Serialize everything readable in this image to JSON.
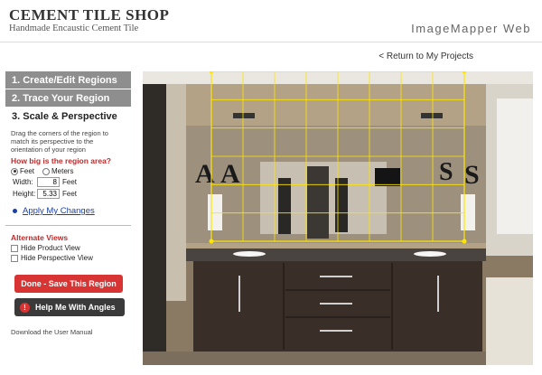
{
  "brand": {
    "title": "CEMENT TILE SHOP",
    "subtitle": "Handmade Encaustic Cement Tile"
  },
  "app": {
    "title": "ImageMapper Web"
  },
  "nav": {
    "return_link": "< Return to My Projects"
  },
  "steps": [
    {
      "label": "1. Create/Edit Regions"
    },
    {
      "label": "2. Trace Your Region"
    },
    {
      "label": "3. Scale & Perspective"
    }
  ],
  "scale": {
    "hint": "Drag the corners of the region to match its perspective to the orientation of your region",
    "question": "How big is the region area?",
    "unit_feet": "Feet",
    "unit_meters": "Meters",
    "selected_unit": "Feet",
    "width_label": "Width:",
    "width_value": "8",
    "height_label": "Height:",
    "height_value": "5.33",
    "unit_suffix": "Feet",
    "apply_label": "Apply My Changes"
  },
  "alternate_views": {
    "title": "Alternate Views",
    "hide_product": "Hide Product View",
    "hide_perspective": "Hide Perspective View"
  },
  "buttons": {
    "done": "Done - Save This Region",
    "help": "Help Me With Angles",
    "help_icon": "!"
  },
  "footer": {
    "manual_link": "Download the User Manual"
  },
  "photo": {
    "wall_letters": [
      "A",
      "A",
      "S",
      "S"
    ],
    "overlay_grid_color": "#ffe600",
    "grid_columns": 8,
    "grid_rows": 6
  }
}
